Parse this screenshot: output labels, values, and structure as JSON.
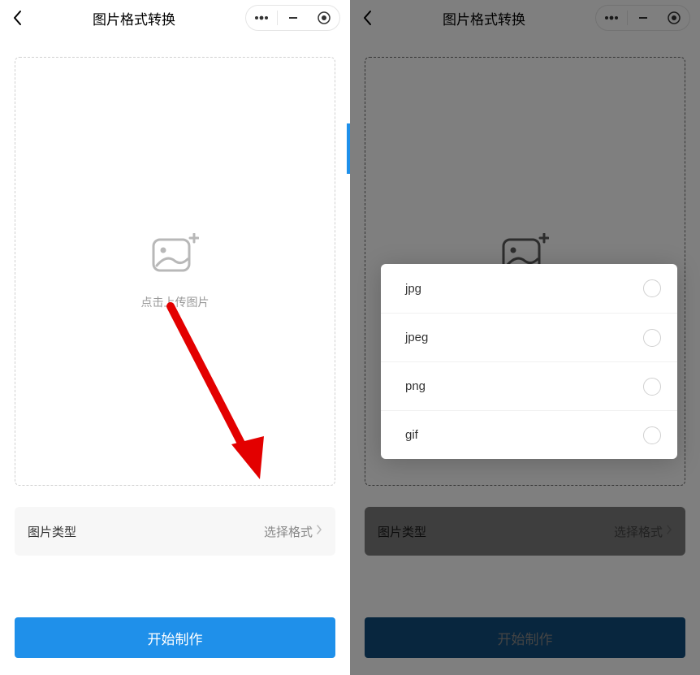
{
  "header": {
    "title": "图片格式转换"
  },
  "upload": {
    "hint": "点击上传图片"
  },
  "typeRow": {
    "label": "图片类型",
    "value": "选择格式"
  },
  "startBtn": {
    "label": "开始制作"
  },
  "formats": [
    {
      "label": "jpg"
    },
    {
      "label": "jpeg"
    },
    {
      "label": "png"
    },
    {
      "label": "gif"
    }
  ]
}
